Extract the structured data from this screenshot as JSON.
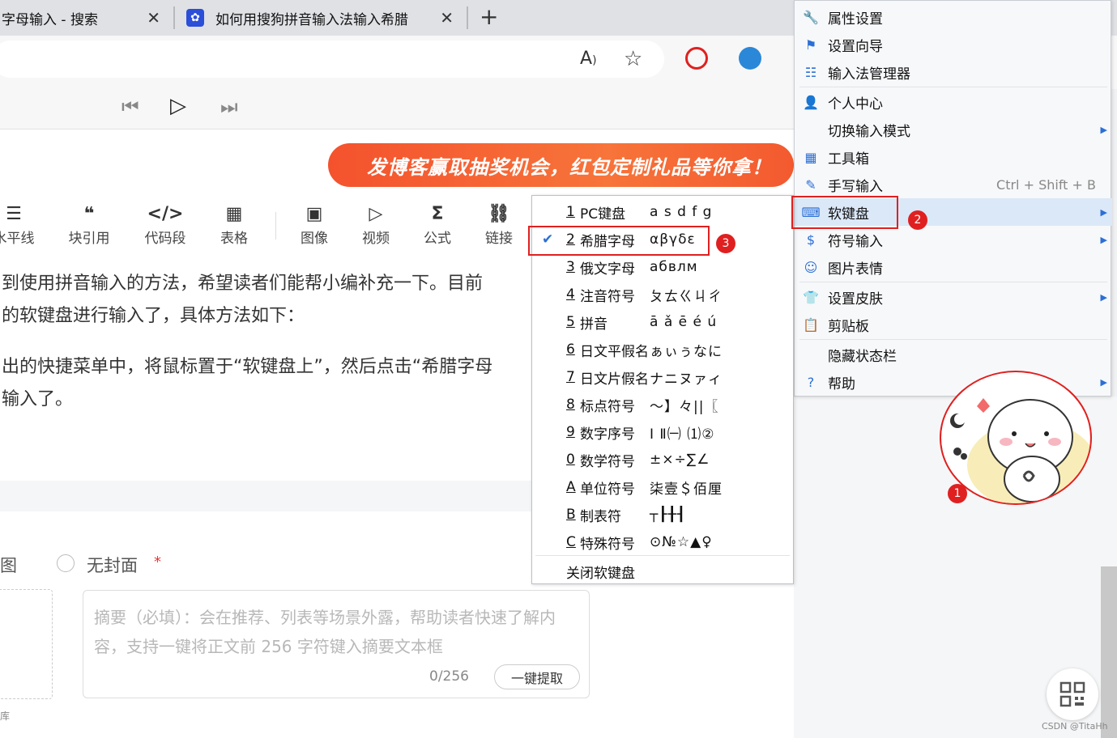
{
  "tabs": [
    {
      "title": "字母输入 - 搜索",
      "close": "✕"
    },
    {
      "title": "如何用搜狗拼音输入法输入希腊",
      "close": "✕"
    }
  ],
  "new_tab": "+",
  "banner": "发博客赢取抽奖机会，红包定制礼品等你拿！",
  "toolbar": [
    {
      "label": "水平线",
      "icon": "☰"
    },
    {
      "label": "块引用",
      "icon": "❝"
    },
    {
      "label": "代码段",
      "icon": "</>"
    },
    {
      "label": "表格",
      "icon": "▦"
    },
    {
      "label": "图像",
      "icon": "▣"
    },
    {
      "label": "视频",
      "icon": "▷"
    },
    {
      "label": "公式",
      "icon": "Σ"
    },
    {
      "label": "链接",
      "icon": "⛓"
    }
  ],
  "article": {
    "line1": "到使用拼音输入的方法，希望读者们能帮小编补充一下。目前",
    "line2": "的软键盘进行输入了，具体方法如下：",
    "line3": "出的快捷菜单中，将鼠标置于“软键盘上”，然后点击“希腊字母",
    "line4": "输入了。"
  },
  "cover": {
    "label": "图",
    "no_cover": "无封面",
    "required": "*"
  },
  "summary": {
    "placeholder": "摘要（必填）：会在推荐、列表等场景外露，帮助读者快速了解内容，支持一键将正文前 256 字符键入摘要文本框",
    "count": "0/256",
    "extract_button": "一键提取"
  },
  "bottom_text": "库",
  "main_menu": [
    {
      "label": "属性设置",
      "icon": "wrench-icon"
    },
    {
      "label": "设置向导",
      "icon": "flag-icon"
    },
    {
      "label": "输入法管理器",
      "icon": "list-icon"
    },
    {
      "label": "个人中心",
      "icon": "person-icon"
    },
    {
      "label": "切换输入模式",
      "icon": "",
      "arrow": "▶"
    },
    {
      "label": "工具箱",
      "icon": "grid-icon"
    },
    {
      "label": "手写输入",
      "icon": "pen-icon",
      "shortcut": "Ctrl + Shift + B"
    },
    {
      "label": "软键盘",
      "icon": "keyboard-icon",
      "arrow": "▶"
    },
    {
      "label": "符号输入",
      "icon": "dollar-icon",
      "arrow": "▶"
    },
    {
      "label": "图片表情",
      "icon": "smile-icon"
    },
    {
      "label": "设置皮肤",
      "icon": "shirt-icon",
      "arrow": "▶"
    },
    {
      "label": "剪贴板",
      "icon": "clipboard-icon"
    },
    {
      "label": "隐藏状态栏",
      "icon": ""
    },
    {
      "label": "帮助",
      "icon": "help-icon",
      "arrow": "▶"
    }
  ],
  "soft_keyboard_menu": [
    {
      "key": "1",
      "name": "PC键盘",
      "sample": "a s d f g"
    },
    {
      "key": "2",
      "name": "希腊字母",
      "sample": "αβγδε",
      "checked": "✔"
    },
    {
      "key": "3",
      "name": "俄文字母",
      "sample": "абвлм"
    },
    {
      "key": "4",
      "name": "注音符号",
      "sample": "ㄆㄊㄍㄐㄔ"
    },
    {
      "key": "5",
      "name": "拼音",
      "sample": "ā ǎ ē é ú"
    },
    {
      "key": "6",
      "name": "日文平假名",
      "sample": "ぁぃぅなに"
    },
    {
      "key": "7",
      "name": "日文片假名",
      "sample": "ナニヌァィ"
    },
    {
      "key": "8",
      "name": "标点符号",
      "sample": "～】々||〖"
    },
    {
      "key": "9",
      "name": "数字序号",
      "sample": "Ⅰ Ⅱ㈠ ⑴②"
    },
    {
      "key": "0",
      "name": "数学符号",
      "sample": "±×÷∑∠"
    },
    {
      "key": "A",
      "name": "单位符号",
      "sample": "柒壹＄佰厘"
    },
    {
      "key": "B",
      "name": "制表符",
      "sample": "┬┠╂┨"
    },
    {
      "key": "C",
      "name": "特殊符号",
      "sample": "⊙№☆▲♀"
    },
    {
      "key": "",
      "name": "关闭软键盘",
      "sample": ""
    }
  ],
  "badges": [
    "1",
    "2",
    "3"
  ],
  "watermark": "CSDN @TitaHh",
  "colors": {
    "highlight": "#dbe8f8",
    "annotation": "#e02020",
    "accent": "#2b6fd6",
    "banner": "#f4522d"
  }
}
